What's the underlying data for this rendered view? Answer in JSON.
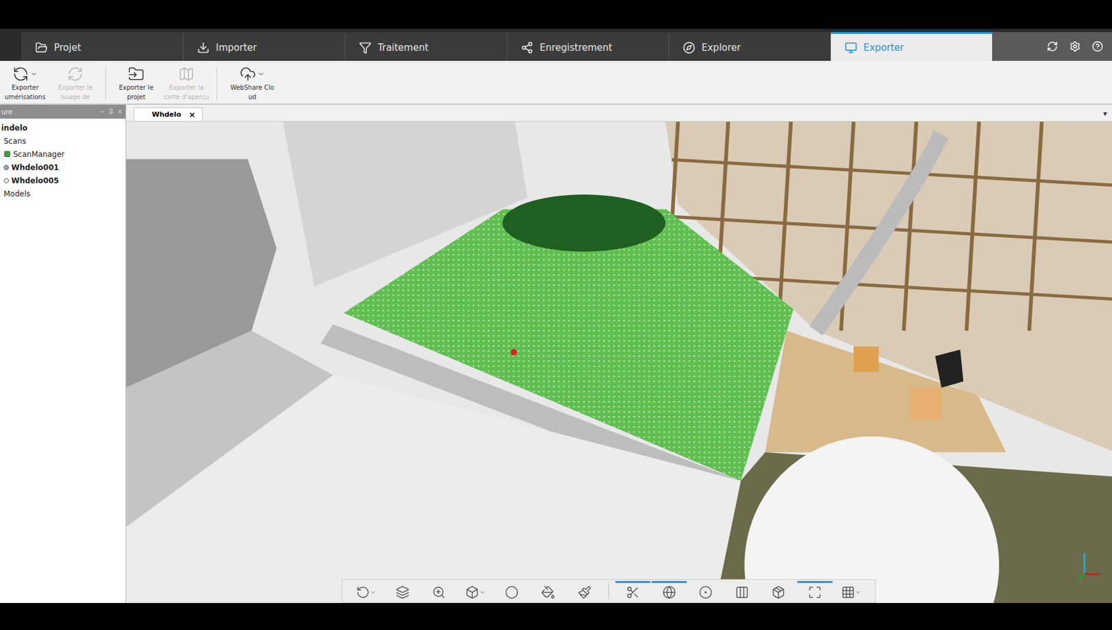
{
  "tabs": [
    {
      "label": "Projet",
      "selected": false
    },
    {
      "label": "Importer",
      "selected": false
    },
    {
      "label": "Traitement",
      "selected": false
    },
    {
      "label": "Enregistrement",
      "selected": false
    },
    {
      "label": "Explorer",
      "selected": false
    },
    {
      "label": "Exporter",
      "selected": true
    }
  ],
  "ribbon": [
    {
      "lines": [
        "Exporter",
        "umérisations"
      ],
      "disabled": false,
      "dropdown": true
    },
    {
      "lines": [
        "Exporter le",
        "nuage de"
      ],
      "disabled": true,
      "dropdown": false
    },
    {
      "lines": [
        "Exporter le",
        "projet"
      ],
      "disabled": false,
      "dropdown": false
    },
    {
      "lines": [
        "Exporter la",
        "carte d'aperçu"
      ],
      "disabled": true,
      "dropdown": false
    },
    {
      "lines": [
        "WebShare Clo",
        "ud"
      ],
      "disabled": false,
      "dropdown": true
    }
  ],
  "structure": {
    "header": "ure",
    "items": [
      {
        "label": "indelo",
        "kind": "root",
        "bold": true,
        "loaded": false
      },
      {
        "label": "Scans",
        "kind": "folder",
        "bold": false,
        "loaded": false
      },
      {
        "label": "ScanManager",
        "kind": "manager",
        "bold": false,
        "loaded": false
      },
      {
        "label": "Whdelo001",
        "kind": "scan",
        "bold": true,
        "loaded": true
      },
      {
        "label": "Whdelo005",
        "kind": "scan",
        "bold": true,
        "loaded": false
      },
      {
        "label": "Models",
        "kind": "folder",
        "bold": false,
        "loaded": false
      }
    ]
  },
  "view_tabs": [
    {
      "label": "Whdelo",
      "close": "×",
      "selected": true
    }
  ],
  "view_menu": "▾",
  "toolbar": [
    [
      {
        "active": false,
        "dropdown": true
      },
      {
        "active": false,
        "dropdown": false
      },
      {
        "active": false,
        "dropdown": false
      },
      {
        "active": false,
        "dropdown": true
      },
      {
        "active": false,
        "dropdown": false
      },
      {
        "active": false,
        "dropdown": false
      },
      {
        "active": false,
        "dropdown": false
      }
    ],
    [
      {
        "active": true,
        "dropdown": false
      },
      {
        "active": true,
        "dropdown": false
      },
      {
        "active": false,
        "dropdown": false
      },
      {
        "active": false,
        "dropdown": false
      },
      {
        "active": false,
        "dropdown": false
      },
      {
        "active": true,
        "dropdown": false
      },
      {
        "active": false,
        "dropdown": true
      }
    ]
  ]
}
